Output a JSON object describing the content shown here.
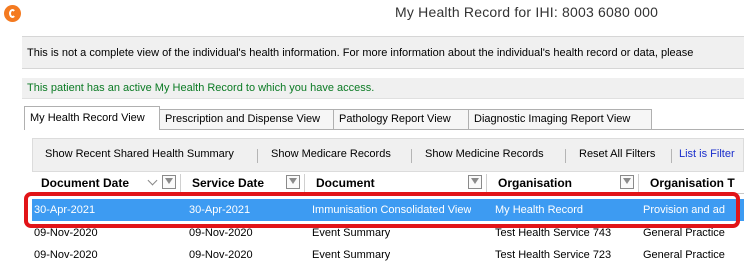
{
  "window": {
    "title": "My Health Record for IHI: 8003 6080 000",
    "icon": "app-logo-icon"
  },
  "notice": "This is not a complete view of the individual's health information. For more information about the individual's health record or data, please",
  "access_message": "This patient has an active My Health Record to which you have access.",
  "tabs": [
    {
      "label": "My Health Record View",
      "active": true
    },
    {
      "label": "Prescription and Dispense View",
      "active": false
    },
    {
      "label": "Pathology Report View",
      "active": false
    },
    {
      "label": "Diagnostic Imaging Report View",
      "active": false
    }
  ],
  "toolbar": {
    "recent_summary": "Show Recent Shared Health Summary",
    "medicare": "Show Medicare Records",
    "medicine": "Show Medicine Records",
    "reset_filters": "Reset All Filters",
    "filter_status": "List is Filter"
  },
  "table": {
    "columns": [
      "Document Date",
      "Service Date",
      "Document",
      "Organisation",
      "Organisation T"
    ],
    "rows": [
      {
        "document_date": "30-Apr-2021",
        "service_date": "30-Apr-2021",
        "document": "Immunisation Consolidated View",
        "organisation": "My Health Record",
        "organisation_type": "Provision and ad",
        "selected": true
      },
      {
        "document_date": "09-Nov-2020",
        "service_date": "09-Nov-2020",
        "document": "Event Summary",
        "organisation": "Test Health Service 743",
        "organisation_type": "General Practice",
        "selected": false
      },
      {
        "document_date": "09-Nov-2020",
        "service_date": "09-Nov-2020",
        "document": "Event Summary",
        "organisation": "Test Health Service 723",
        "organisation_type": "General Practice",
        "selected": false
      }
    ]
  },
  "colors": {
    "selection": "#3d9bf2",
    "highlight": "#e11418",
    "access_text": "#0a7a23",
    "link": "#1a2ecc"
  }
}
